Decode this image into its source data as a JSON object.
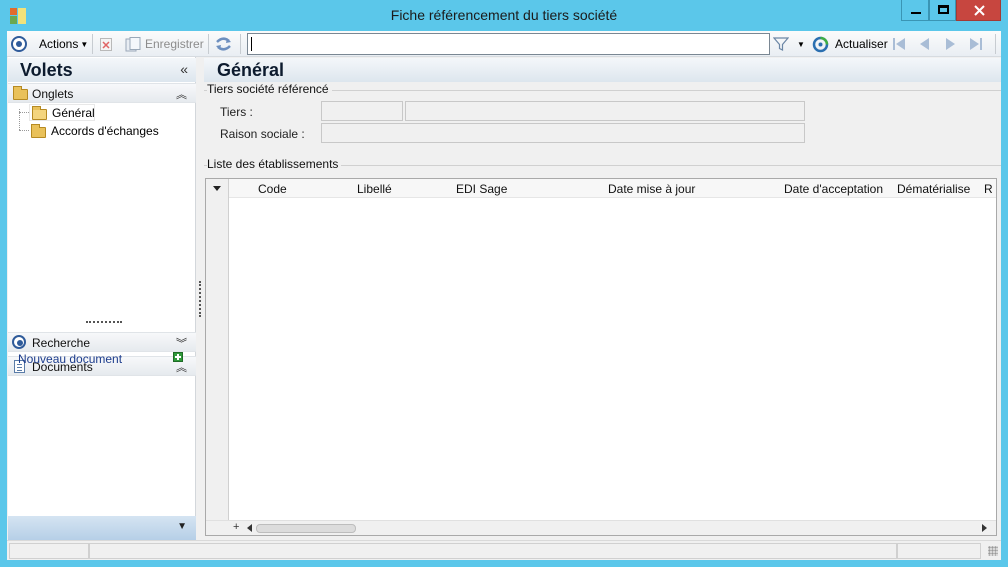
{
  "window": {
    "title": "Fiche référencement du tiers société",
    "controls": {
      "minimize": "minimize",
      "maximize": "maximize",
      "close": "close"
    }
  },
  "toolbar": {
    "actions_label": "Actions",
    "save_label": "Enregistrer",
    "search_value": "",
    "refresh_label": "Actualiser"
  },
  "left_panel": {
    "title": "Volets",
    "collapse_glyph": "«",
    "onglets_label": "Onglets",
    "tree_items": [
      "Général",
      "Accords d'échanges"
    ],
    "recherche_label": "Recherche",
    "documents_label": "Documents",
    "new_document_label": "Nouveau document"
  },
  "main": {
    "title": "Général",
    "group1_title": "Tiers société référencé",
    "tiers_label": "Tiers :",
    "raison_label": "Raison sociale :",
    "tiers_code_value": "",
    "tiers_name_value": "",
    "raison_value": "",
    "group2_title": "Liste des établissements",
    "columns": [
      "Code",
      "Libellé",
      "EDI Sage",
      "Date mise à jour",
      "Date d'acceptation",
      "Dématérialise",
      "R"
    ]
  },
  "colors": {
    "window_frame": "#5bc7ea",
    "close_button": "#c7463f",
    "panel_header": "#dde6ee",
    "link": "#1c3c8c"
  },
  "icons": [
    "app-icon",
    "actions-icon",
    "delete-icon",
    "save-icon",
    "refresh-icon",
    "filter-icon",
    "actualiser-icon",
    "first-record-icon",
    "previous-record-icon",
    "next-record-icon",
    "last-record-icon",
    "folder-icon",
    "search-icon",
    "document-icon",
    "plus-icon"
  ]
}
